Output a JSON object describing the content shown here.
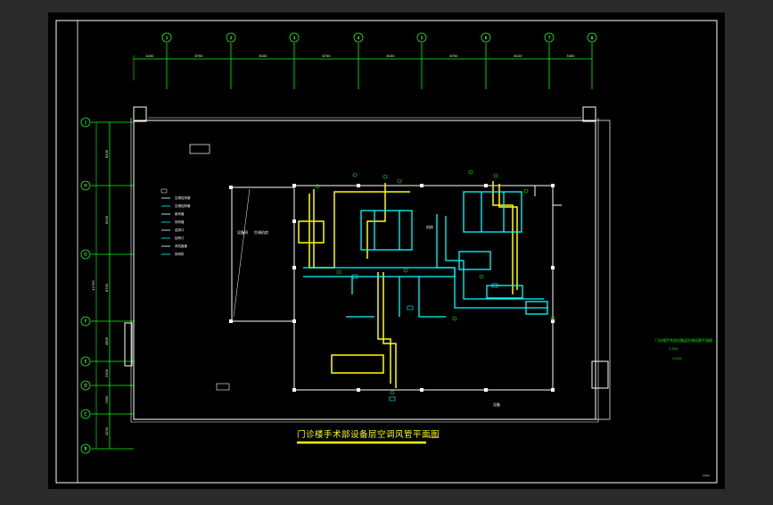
{
  "drawing": {
    "title": "门诊楼手术部设备层空调风管平面图",
    "scale": "1:100",
    "side_note": {
      "title": "门诊楼手术部设备层空调风管平面图",
      "line2": "1:100",
      "line3": "1:100"
    }
  },
  "axis_labels_top": [
    "1",
    "2",
    "3",
    "4",
    "5",
    "6",
    "7",
    "8"
  ],
  "top_dimensions": [
    "4200",
    "8700",
    "8100",
    "8700",
    "8100",
    "8700",
    "8100",
    "5400"
  ],
  "axis_labels_left": [
    "J",
    "H",
    "G",
    "F",
    "E",
    "D",
    "C",
    "B"
  ],
  "left_dimensions": [
    "8100",
    "8100",
    "8700",
    "4800",
    "3300",
    "3300",
    "4200"
  ],
  "left_total_dimension": "41700",
  "legend": [
    "空调送风管",
    "空调回风管",
    "新风管",
    "排风管",
    "送风口",
    "回风口",
    "风机盘管",
    "排风机"
  ],
  "room_labels": {
    "room_a": "设备间",
    "room_b": "空调机房",
    "room_c": "机房",
    "room_d": "设备"
  },
  "colors": {
    "background": "#000000",
    "supply_duct": "#ffff00",
    "return_duct": "#00ffff",
    "grid_axis": "#00ff00",
    "walls": "#ffffff",
    "chrome": "#2a2a2a"
  }
}
